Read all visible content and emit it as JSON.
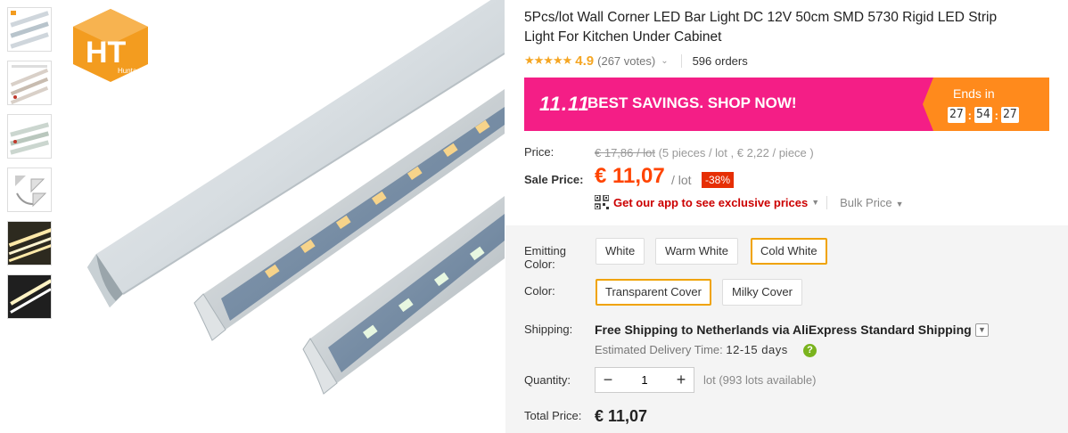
{
  "thumbnails": [
    {
      "name": "thumb-1",
      "color": "#cfd6dc"
    },
    {
      "name": "thumb-2",
      "color": "#d9d0c8"
    },
    {
      "name": "thumb-3",
      "color": "#cbd6cf"
    },
    {
      "name": "thumb-4",
      "color": "#e6e6e6"
    },
    {
      "name": "thumb-5",
      "color": "#2d2a1f"
    },
    {
      "name": "thumb-6",
      "color": "#1f1f1f"
    }
  ],
  "brand_logo": {
    "letters": "HT",
    "sub": "Hunta",
    "color": "#f39c1f"
  },
  "product": {
    "title": "5Pcs/lot Wall Corner LED Bar Light DC 12V 50cm SMD 5730 Rigid LED Strip Light For Kitchen Under Cabinet",
    "rating": "4.9",
    "votes": "(267 votes)",
    "orders": "596 orders"
  },
  "banner": {
    "logo": "11.11",
    "text": "BEST SAVINGS. SHOP NOW!",
    "ends_label": "Ends in",
    "timer": {
      "h": "27",
      "m": "54",
      "s": "27"
    },
    "colors": {
      "pink": "#f41e86",
      "orange": "#ff8a1c"
    }
  },
  "pricing": {
    "price_label": "Price:",
    "old_price": "€ 17,86 / lot",
    "old_detail": "(5 pieces / lot , € 2,22 / piece )",
    "sale_label": "Sale Price:",
    "sale_price": "€ 11,07",
    "per_lot": "/ lot",
    "discount": "-38%",
    "app_text": "Get our app to see exclusive prices",
    "bulk_text": "Bulk Price"
  },
  "options": {
    "emitting_label_1": "Emitting",
    "emitting_label_2": "Color:",
    "emitting": [
      "White",
      "Warm White",
      "Cold White"
    ],
    "emitting_selected": "Cold White",
    "color_label": "Color:",
    "colors": [
      "Transparent Cover",
      "Milky Cover"
    ],
    "color_selected": "Transparent Cover"
  },
  "shipping": {
    "label": "Shipping:",
    "main": "Free Shipping to Netherlands via AliExpress Standard Shipping",
    "est_label": "Estimated Delivery Time:",
    "est_days": "12-15 days"
  },
  "quantity": {
    "label": "Quantity:",
    "value": "1",
    "available": "lot (993 lots available)"
  },
  "total": {
    "label": "Total Price:",
    "value": "€ 11,07"
  }
}
